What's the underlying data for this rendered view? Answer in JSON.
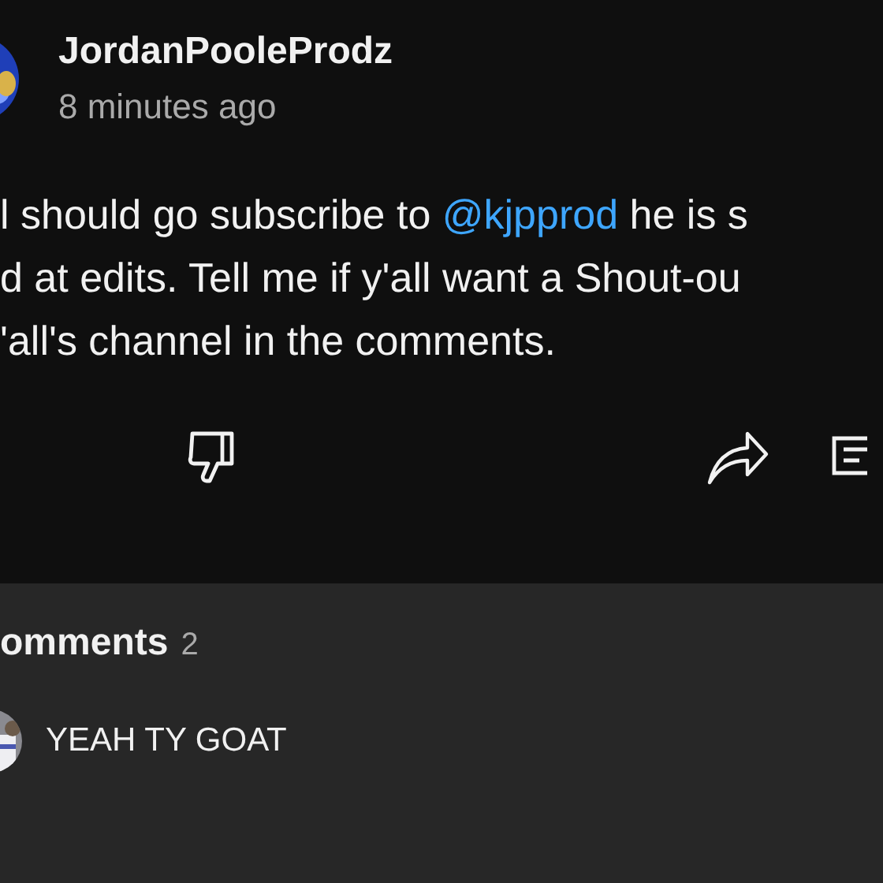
{
  "post": {
    "author": "JordanPooleProdz",
    "time": "8 minutes ago",
    "lines": [
      [
        {
          "kind": "text",
          "text": "l should go subscribe to "
        },
        {
          "kind": "mention",
          "text": "@kjpprod"
        },
        {
          "kind": "text",
          "text": " he is s"
        }
      ],
      [
        {
          "kind": "text",
          "text": "d at edits. Tell me if y'all want a Shout-ou"
        }
      ],
      [
        {
          "kind": "text",
          "text": "'all's channel in the comments."
        }
      ]
    ]
  },
  "comments": {
    "title": "omments",
    "count": "2",
    "top_comment": "YEAH TY GOAT"
  }
}
